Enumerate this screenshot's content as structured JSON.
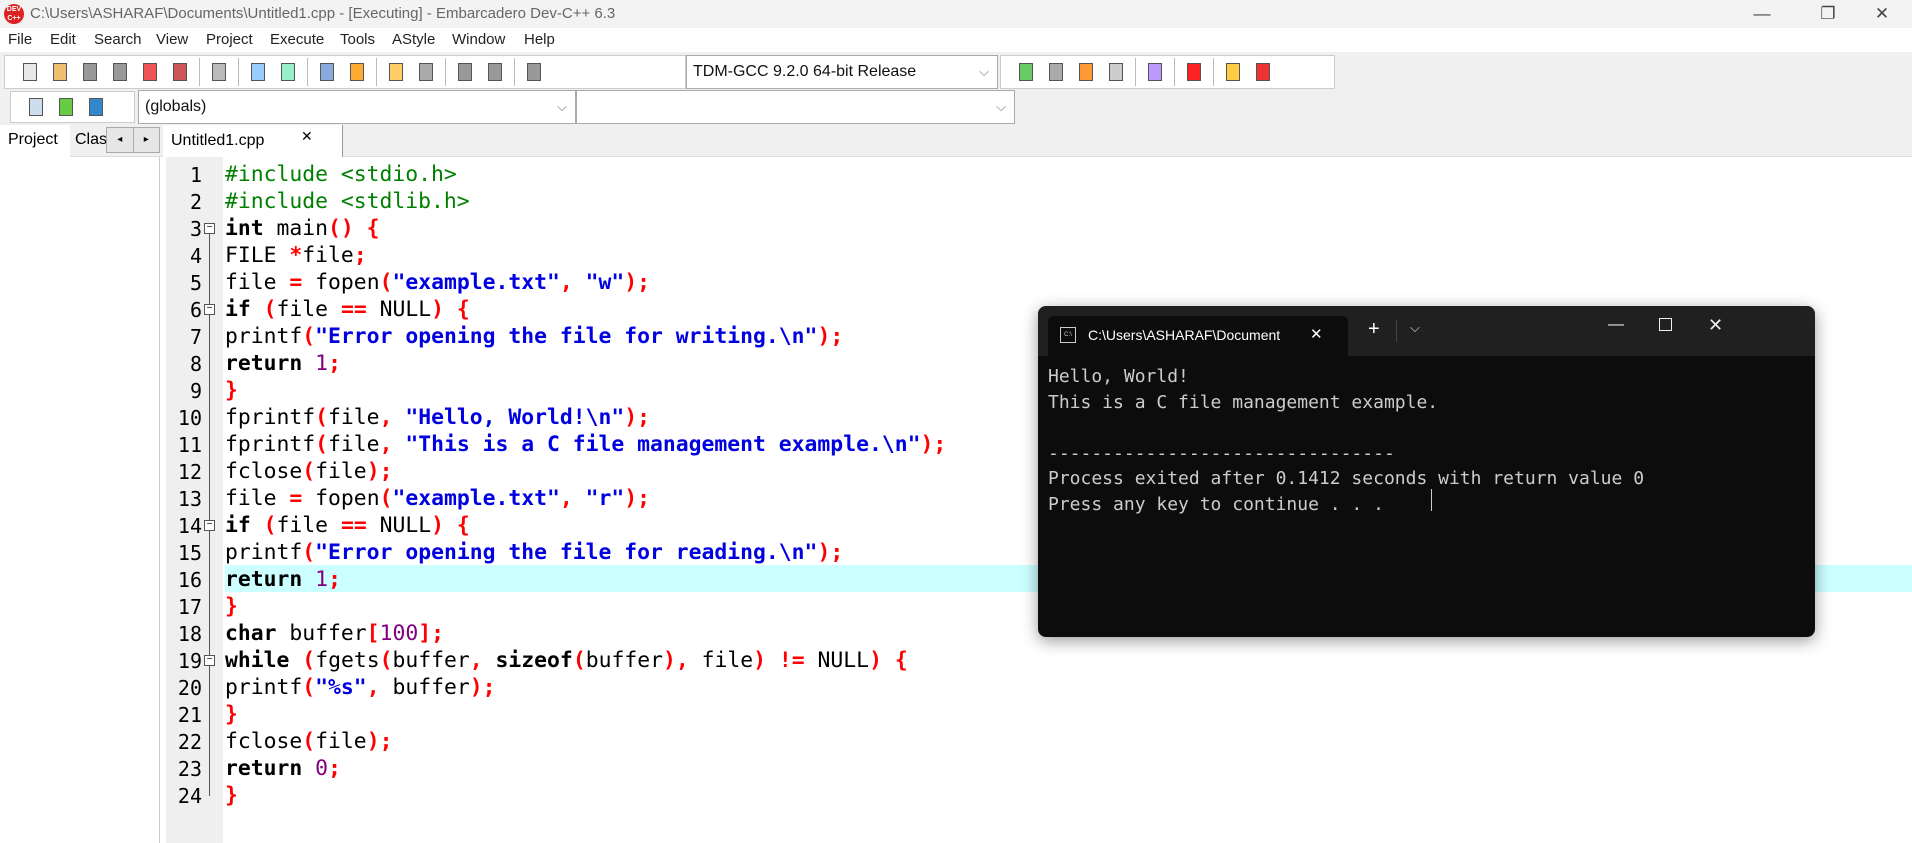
{
  "window": {
    "title": "C:\\Users\\ASHARAF\\Documents\\Untitled1.cpp - [Executing] - Embarcadero Dev-C++ 6.3",
    "logo": "DEV C++"
  },
  "menu": [
    "File",
    "Edit",
    "Search",
    "View",
    "Project",
    "Execute",
    "Tools",
    "AStyle",
    "Window",
    "Help"
  ],
  "toolbar": {
    "compiler": "TDM-GCC 9.2.0 64-bit Release",
    "scope": "(globals)",
    "member": ""
  },
  "left_tabs": [
    "Project",
    "Clas"
  ],
  "editor_tab": "Untitled1.cpp",
  "highlighted_line": 16,
  "code": [
    [
      [
        "#include <stdio.h>",
        "pp"
      ]
    ],
    [
      [
        "#include <stdlib.h>",
        "pp"
      ]
    ],
    [
      [
        "int",
        "kw"
      ],
      [
        " main",
        ""
      ],
      [
        "() {",
        "sy"
      ]
    ],
    [
      [
        "FILE ",
        ""
      ],
      [
        "*",
        "sy"
      ],
      [
        "file",
        ""
      ],
      [
        ";",
        "sy"
      ]
    ],
    [
      [
        "file ",
        ""
      ],
      [
        "=",
        "sy"
      ],
      [
        " fopen",
        ""
      ],
      [
        "(",
        "sy"
      ],
      [
        "\"example.txt\"",
        "st"
      ],
      [
        ", ",
        "sy"
      ],
      [
        "\"w\"",
        "st"
      ],
      [
        ");",
        "sy"
      ]
    ],
    [
      [
        "if",
        "kw"
      ],
      [
        " ",
        ""
      ],
      [
        "(",
        "sy"
      ],
      [
        "file ",
        ""
      ],
      [
        "==",
        "sy"
      ],
      [
        " NULL",
        ""
      ],
      [
        ") {",
        "sy"
      ]
    ],
    [
      [
        "printf",
        ""
      ],
      [
        "(",
        "sy"
      ],
      [
        "\"Error opening the file for writing.\\n\"",
        "st"
      ],
      [
        ");",
        "sy"
      ]
    ],
    [
      [
        "return",
        "kw"
      ],
      [
        " ",
        ""
      ],
      [
        "1",
        "nu"
      ],
      [
        ";",
        "sy"
      ]
    ],
    [
      [
        "}",
        "sy"
      ]
    ],
    [
      [
        "fprintf",
        ""
      ],
      [
        "(",
        "sy"
      ],
      [
        "file",
        ""
      ],
      [
        ", ",
        "sy"
      ],
      [
        "\"Hello, World!\\n\"",
        "st"
      ],
      [
        ");",
        "sy"
      ]
    ],
    [
      [
        "fprintf",
        ""
      ],
      [
        "(",
        "sy"
      ],
      [
        "file",
        ""
      ],
      [
        ", ",
        "sy"
      ],
      [
        "\"This is a C file management example.\\n\"",
        "st"
      ],
      [
        ");",
        "sy"
      ]
    ],
    [
      [
        "fclose",
        ""
      ],
      [
        "(",
        "sy"
      ],
      [
        "file",
        ""
      ],
      [
        ");",
        "sy"
      ]
    ],
    [
      [
        "file ",
        ""
      ],
      [
        "=",
        "sy"
      ],
      [
        " fopen",
        ""
      ],
      [
        "(",
        "sy"
      ],
      [
        "\"example.txt\"",
        "st"
      ],
      [
        ", ",
        "sy"
      ],
      [
        "\"r\"",
        "st"
      ],
      [
        ");",
        "sy"
      ]
    ],
    [
      [
        "if",
        "kw"
      ],
      [
        " ",
        ""
      ],
      [
        "(",
        "sy"
      ],
      [
        "file ",
        ""
      ],
      [
        "==",
        "sy"
      ],
      [
        " NULL",
        ""
      ],
      [
        ") {",
        "sy"
      ]
    ],
    [
      [
        "printf",
        ""
      ],
      [
        "(",
        "sy"
      ],
      [
        "\"Error opening the file for reading.\\n\"",
        "st"
      ],
      [
        ");",
        "sy"
      ]
    ],
    [
      [
        "return",
        "kw"
      ],
      [
        " ",
        ""
      ],
      [
        "1",
        "nu"
      ],
      [
        ";",
        "sy"
      ]
    ],
    [
      [
        "}",
        "sy"
      ]
    ],
    [
      [
        "char",
        "kw"
      ],
      [
        " buffer",
        ""
      ],
      [
        "[",
        "sy"
      ],
      [
        "100",
        "nu"
      ],
      [
        "];",
        "sy"
      ]
    ],
    [
      [
        "while",
        "kw"
      ],
      [
        " ",
        ""
      ],
      [
        "(",
        "sy"
      ],
      [
        "fgets",
        ""
      ],
      [
        "(",
        "sy"
      ],
      [
        "buffer",
        ""
      ],
      [
        ", ",
        "sy"
      ],
      [
        "sizeof",
        "kw"
      ],
      [
        "(",
        "sy"
      ],
      [
        "buffer",
        ""
      ],
      [
        "), ",
        "sy"
      ],
      [
        "file",
        ""
      ],
      [
        ") ",
        "sy"
      ],
      [
        "!=",
        "sy"
      ],
      [
        " NULL",
        ""
      ],
      [
        ") {",
        "sy"
      ]
    ],
    [
      [
        "printf",
        ""
      ],
      [
        "(",
        "sy"
      ],
      [
        "\"%s\"",
        "st"
      ],
      [
        ", ",
        "sy"
      ],
      [
        "buffer",
        ""
      ],
      [
        ");",
        "sy"
      ]
    ],
    [
      [
        "}",
        "sy"
      ]
    ],
    [
      [
        "fclose",
        ""
      ],
      [
        "(",
        "sy"
      ],
      [
        "file",
        ""
      ],
      [
        ");",
        "sy"
      ]
    ],
    [
      [
        "return",
        "kw"
      ],
      [
        " ",
        ""
      ],
      [
        "0",
        "nu"
      ],
      [
        ";",
        "sy"
      ]
    ],
    [
      [
        "}",
        "sy"
      ]
    ]
  ],
  "fold_lines": [
    3,
    6,
    14,
    19
  ],
  "terminal": {
    "tab_title": "C:\\Users\\ASHARAF\\Document",
    "output": "Hello, World!\nThis is a C file management example.\n\n--------------------------------\nProcess exited after 0.1412 seconds with return value 0\nPress any key to continue . . . "
  }
}
